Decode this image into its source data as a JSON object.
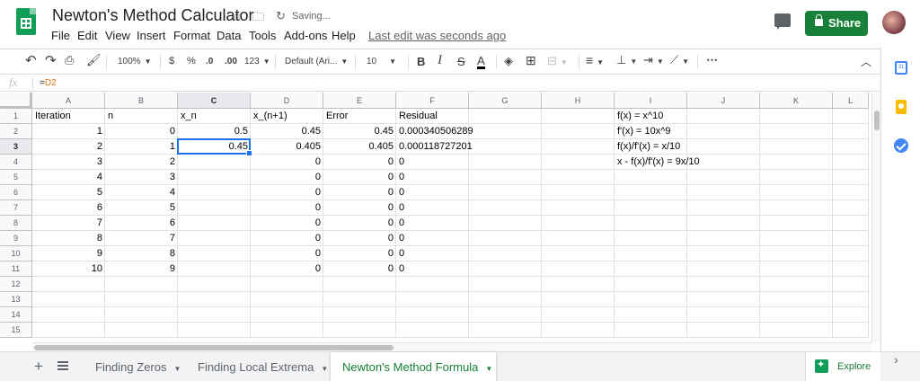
{
  "document": {
    "title": "Newton's Method Calculator",
    "status": "Saving...",
    "last_edit": "Last edit was seconds ago"
  },
  "menu": [
    "File",
    "Edit",
    "View",
    "Insert",
    "Format",
    "Data",
    "Tools",
    "Add-ons",
    "Help"
  ],
  "share_label": "Share",
  "toolbar": {
    "zoom": "100%",
    "currency": "$",
    "percent": "%",
    "decrease_decimals": ".0",
    "increase_decimals": ".00",
    "more_formats": "123",
    "font": "Default (Ari...",
    "font_size": "10",
    "bold": "B",
    "italic": "I",
    "strike": "S",
    "text_color": "A",
    "more": "⋯"
  },
  "formula_bar": {
    "fx_label": "fx",
    "formula_prefix": "=",
    "formula_ref": "D2"
  },
  "columns": [
    "A",
    "B",
    "C",
    "D",
    "E",
    "F",
    "G",
    "H",
    "I",
    "J",
    "K",
    "L"
  ],
  "selected_column": "C",
  "selected_row": 3,
  "row_numbers": [
    "1",
    "2",
    "3",
    "4",
    "5",
    "6",
    "7",
    "8",
    "9",
    "10",
    "11",
    "12",
    "13",
    "14",
    "15"
  ],
  "headers": [
    "Iteration",
    "n",
    "x_n",
    "x_(n+1)",
    "Error",
    "Residual"
  ],
  "rows": [
    [
      "1",
      "0",
      "0.5",
      "0.45",
      "0.45",
      "0.000340506289"
    ],
    [
      "2",
      "1",
      "0.45",
      "0.405",
      "0.405",
      "0.000118727201"
    ],
    [
      "3",
      "2",
      "",
      "0",
      "0",
      "0"
    ],
    [
      "4",
      "3",
      "",
      "0",
      "0",
      "0"
    ],
    [
      "5",
      "4",
      "",
      "0",
      "0",
      "0"
    ],
    [
      "6",
      "5",
      "",
      "0",
      "0",
      "0"
    ],
    [
      "7",
      "6",
      "",
      "0",
      "0",
      "0"
    ],
    [
      "8",
      "7",
      "",
      "0",
      "0",
      "0"
    ],
    [
      "9",
      "8",
      "",
      "0",
      "0",
      "0"
    ],
    [
      "10",
      "9",
      "",
      "0",
      "0",
      "0"
    ]
  ],
  "notes": [
    "f(x) = x^10",
    "f'(x) = 10x^9",
    "f(x)/f'(x) = x/10",
    "x - f(x)/f'(x) = 9x/10"
  ],
  "sheets": [
    {
      "label": "Finding Zeros",
      "active": false
    },
    {
      "label": "Finding Local Extrema",
      "active": false
    },
    {
      "label": "Newton's Method Formula",
      "active": true
    }
  ],
  "explore_label": "Explore",
  "calendar_label": "31",
  "icons": {
    "star": "star-icon",
    "move": "folder-move-icon",
    "sync": "sync-icon",
    "comment": "comment-icon",
    "lock": "lock-icon",
    "undo": "undo-icon",
    "redo": "redo-icon",
    "print": "print-icon",
    "paint_format": "paint-format-icon",
    "fill_color": "fill-color-icon",
    "borders": "borders-icon",
    "merge": "merge-cells-icon",
    "h_align": "horizontal-align-icon",
    "v_align": "vertical-align-icon",
    "wrap": "text-wrap-icon",
    "rotate": "text-rotate-icon",
    "collapse": "chevron-up-icon",
    "add_sheet": "plus-icon",
    "all_sheets": "sheet-list-icon",
    "explore": "explore-icon",
    "calendar": "calendar-icon",
    "keep": "keep-icon",
    "tasks": "tasks-icon",
    "panel_toggle": "chevron-right-icon"
  },
  "colors": {
    "brand_green": "#0f9d58",
    "share_green": "#188038",
    "selection_blue": "#1a73e8",
    "formula_ref": "#e8710a"
  }
}
